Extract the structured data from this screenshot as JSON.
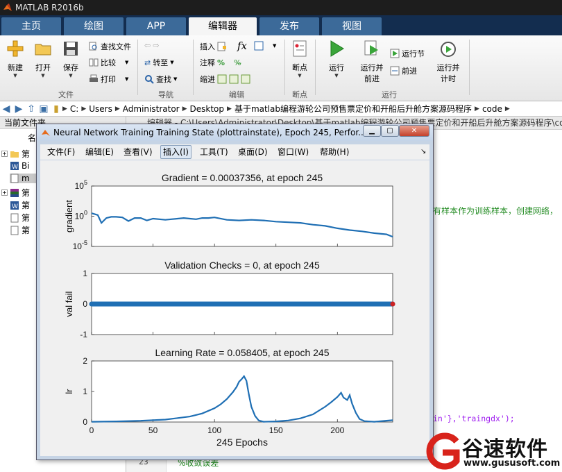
{
  "app": {
    "title": "MATLAB R2016b"
  },
  "tabs": [
    {
      "label": "主页"
    },
    {
      "label": "绘图"
    },
    {
      "label": "APP"
    },
    {
      "label": "编辑器"
    },
    {
      "label": "发布"
    },
    {
      "label": "视图"
    }
  ],
  "ribbon": {
    "file": {
      "new": "新建",
      "open": "打开",
      "save": "保存",
      "find_files": "查找文件",
      "compare": "比较",
      "print": "打印",
      "group": "文件"
    },
    "nav": {
      "goto": "转至",
      "find": "查找",
      "group": "导航"
    },
    "edit": {
      "insert": "插入",
      "comment": "注释",
      "indent": "缩进",
      "group": "编辑"
    },
    "breakpoints": {
      "label": "断点",
      "group": "断点"
    },
    "run": {
      "run": "运行",
      "run_advance_1": "运行并",
      "run_advance_2": "前进",
      "run_section": "运行节",
      "advance": "前进",
      "run_time_1": "运行并",
      "run_time_2": "计时",
      "group": "运行"
    }
  },
  "address": {
    "crumbs": [
      "C:",
      "Users",
      "Administrator",
      "Desktop",
      "基于matlab编程游轮公司预售票定价和开船后升舱方案源码程序",
      "code"
    ]
  },
  "left_pane": {
    "header": "当前文件夹",
    "name_col": "名",
    "items": [
      {
        "label": "第"
      },
      {
        "label": "Bi"
      },
      {
        "label": "m"
      },
      {
        "label": "第"
      },
      {
        "label": "第"
      },
      {
        "label": "第"
      },
      {
        "label": "第"
      }
    ]
  },
  "editor": {
    "header": "编辑器 - C:\\Users\\Administrator\\Desktop\\基于matlab编程游轮公司预售票定价和开船后升舱方案源码程序\\code",
    "line_a": "有样本作为训练样本，创建网络，",
    "line_b": "in'},'traingdx');",
    "line_c_num": "23",
    "line_c": "%收敛误差"
  },
  "figure": {
    "title": "Neural Network Training Training State (plottrainstate), Epoch 245, Perfor...",
    "menu": [
      "文件(F)",
      "编辑(E)",
      "查看(V)",
      "插入(I)",
      "工具(T)",
      "桌面(D)",
      "窗口(W)",
      "帮助(H)"
    ]
  },
  "chart_data": [
    {
      "type": "line",
      "title": "Gradient = 0.00037356, at epoch 245",
      "ylabel": "gradient",
      "yscale": "log",
      "ylim_exp": [
        -5,
        5
      ],
      "yticks": [
        "10^5",
        "10^0",
        "10^-5"
      ],
      "xlim": [
        0,
        245
      ],
      "series": [
        {
          "color": "#1f6fb4",
          "x": [
            0,
            5,
            8,
            12,
            16,
            20,
            25,
            30,
            35,
            40,
            45,
            50,
            55,
            60,
            65,
            70,
            75,
            80,
            85,
            90,
            95,
            100,
            110,
            120,
            130,
            140,
            150,
            160,
            170,
            180,
            190,
            200,
            210,
            220,
            230,
            240,
            245
          ],
          "log10": [
            0.5,
            0.2,
            -1.1,
            -0.3,
            -0.1,
            -0.1,
            -0.2,
            -0.8,
            -0.3,
            -0.3,
            -0.7,
            -0.4,
            -0.5,
            -0.6,
            -0.5,
            -0.4,
            -0.3,
            -0.4,
            -0.5,
            -0.3,
            -0.3,
            -0.2,
            -0.6,
            -0.7,
            -0.6,
            -0.7,
            -0.9,
            -1.0,
            -1.1,
            -1.4,
            -1.6,
            -2.0,
            -2.3,
            -2.5,
            -2.8,
            -3.0,
            -3.4
          ]
        }
      ]
    },
    {
      "type": "scatter",
      "title": "Validation Checks = 0, at epoch 245",
      "ylabel": "val fail",
      "ylim": [
        -1,
        1
      ],
      "yticks": [
        1,
        0,
        -1
      ],
      "xlim": [
        0,
        245
      ],
      "series": [
        {
          "color": "#1f6fb4",
          "value": 0,
          "last_point_color": "#cc2222"
        }
      ]
    },
    {
      "type": "line",
      "title": "Learning Rate = 0.058405, at epoch 245",
      "ylabel": "lr",
      "xlabel": "245 Epochs",
      "ylim": [
        0,
        2
      ],
      "yticks": [
        2,
        1,
        0
      ],
      "xlim": [
        0,
        245
      ],
      "xticks": [
        0,
        50,
        100,
        150,
        200
      ],
      "series": [
        {
          "color": "#1f6fb4",
          "x": [
            0,
            20,
            40,
            60,
            80,
            90,
            100,
            105,
            110,
            115,
            118,
            120,
            122,
            124,
            126,
            128,
            130,
            133,
            136,
            140,
            150,
            160,
            170,
            180,
            190,
            195,
            200,
            203,
            205,
            208,
            210,
            212,
            215,
            218,
            222,
            230,
            245
          ],
          "y": [
            0.01,
            0.02,
            0.04,
            0.08,
            0.18,
            0.28,
            0.45,
            0.58,
            0.75,
            0.98,
            1.15,
            1.32,
            1.4,
            1.5,
            1.35,
            0.9,
            0.5,
            0.2,
            0.05,
            0.01,
            0.02,
            0.05,
            0.12,
            0.25,
            0.5,
            0.65,
            0.82,
            0.96,
            0.8,
            0.72,
            0.88,
            0.6,
            0.3,
            0.1,
            0.03,
            0.01,
            0.06
          ]
        }
      ]
    }
  ],
  "watermark": {
    "name": "谷速软件",
    "url": "www.gususoft.com"
  }
}
